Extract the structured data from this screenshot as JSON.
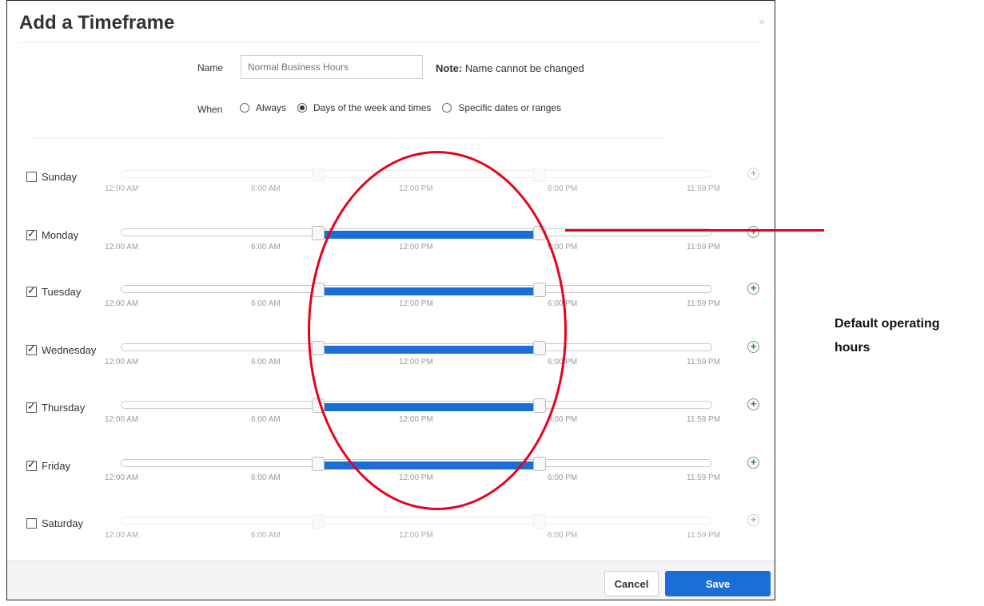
{
  "dialog": {
    "title": "Add a Timeframe",
    "close_glyph": "×"
  },
  "form": {
    "name_label": "Name",
    "name_placeholder": "Normal Business Hours",
    "note_bold": "Note:",
    "note_text": " Name cannot be changed",
    "when_label": "When",
    "when_options": [
      {
        "label": "Always",
        "selected": false
      },
      {
        "label": "Days of the week and times",
        "selected": true
      },
      {
        "label": "Specific dates or ranges",
        "selected": false
      }
    ]
  },
  "tick_labels": [
    "12:00 AM",
    "6:00 AM",
    "12:00 PM",
    "6:00 PM",
    "11:59 PM"
  ],
  "days": [
    {
      "label": "Sunday",
      "checked": false,
      "range_start_hour": 8,
      "range_end_hour": 17
    },
    {
      "label": "Monday",
      "checked": true,
      "range_start_hour": 8,
      "range_end_hour": 17
    },
    {
      "label": "Tuesday",
      "checked": true,
      "range_start_hour": 8,
      "range_end_hour": 17
    },
    {
      "label": "Wednesday",
      "checked": true,
      "range_start_hour": 8,
      "range_end_hour": 17
    },
    {
      "label": "Thursday",
      "checked": true,
      "range_start_hour": 8,
      "range_end_hour": 17
    },
    {
      "label": "Friday",
      "checked": true,
      "range_start_hour": 8,
      "range_end_hour": 17
    },
    {
      "label": "Saturday",
      "checked": false,
      "range_start_hour": 8,
      "range_end_hour": 17
    }
  ],
  "footer": {
    "cancel_label": "Cancel",
    "save_label": "Save"
  },
  "annotation": {
    "label": "Default operating hours",
    "color": "#e8001c"
  },
  "colors": {
    "accent": "#1a6fd6",
    "add_icon": "#1f8a1f"
  },
  "icons": {
    "add": "plus-circle-icon",
    "close": "close-icon"
  }
}
